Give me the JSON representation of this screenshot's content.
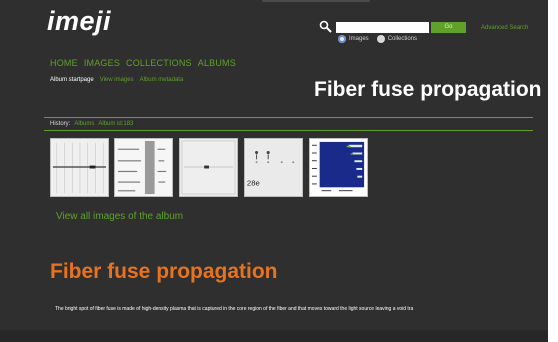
{
  "logo": {
    "text": "imeji"
  },
  "search": {
    "placeholder": "",
    "go_label": "Go",
    "advanced_label": "Advanced Search",
    "options": [
      {
        "label": "Images",
        "selected": true
      },
      {
        "label": "Collections",
        "selected": false
      }
    ]
  },
  "nav": {
    "home": "HOME",
    "images": "IMAGES",
    "collections": "COLLECTIONS",
    "albums": "ALBUMS"
  },
  "subnav": {
    "album_startpage": "Album startpage",
    "view_images": "View images",
    "album_metadata": "Album metadata"
  },
  "header": {
    "title": "Fiber fuse propagation"
  },
  "history": {
    "label": "History:",
    "albums": "Albums",
    "album_id": "Album id:183"
  },
  "gallery": {
    "thumbnails": [
      {
        "name": "thumbnail-1",
        "caption": ""
      },
      {
        "name": "thumbnail-2",
        "caption": ""
      },
      {
        "name": "thumbnail-3",
        "caption": ""
      },
      {
        "name": "thumbnail-4",
        "caption": "28e"
      },
      {
        "name": "thumbnail-5",
        "caption": ""
      }
    ],
    "view_all_label": "View all images of the album"
  },
  "album": {
    "title": "Fiber fuse propagation",
    "description": "The bright spot of fiber fuse is made of high-density plasma that is captured in the core region of the fiber and that moves toward the light source leaving a void tra"
  },
  "colors": {
    "background": "#2f2f2f",
    "accent_green": "#5fa12a",
    "title_orange": "#e8731f",
    "text_white": "#ffffff"
  }
}
